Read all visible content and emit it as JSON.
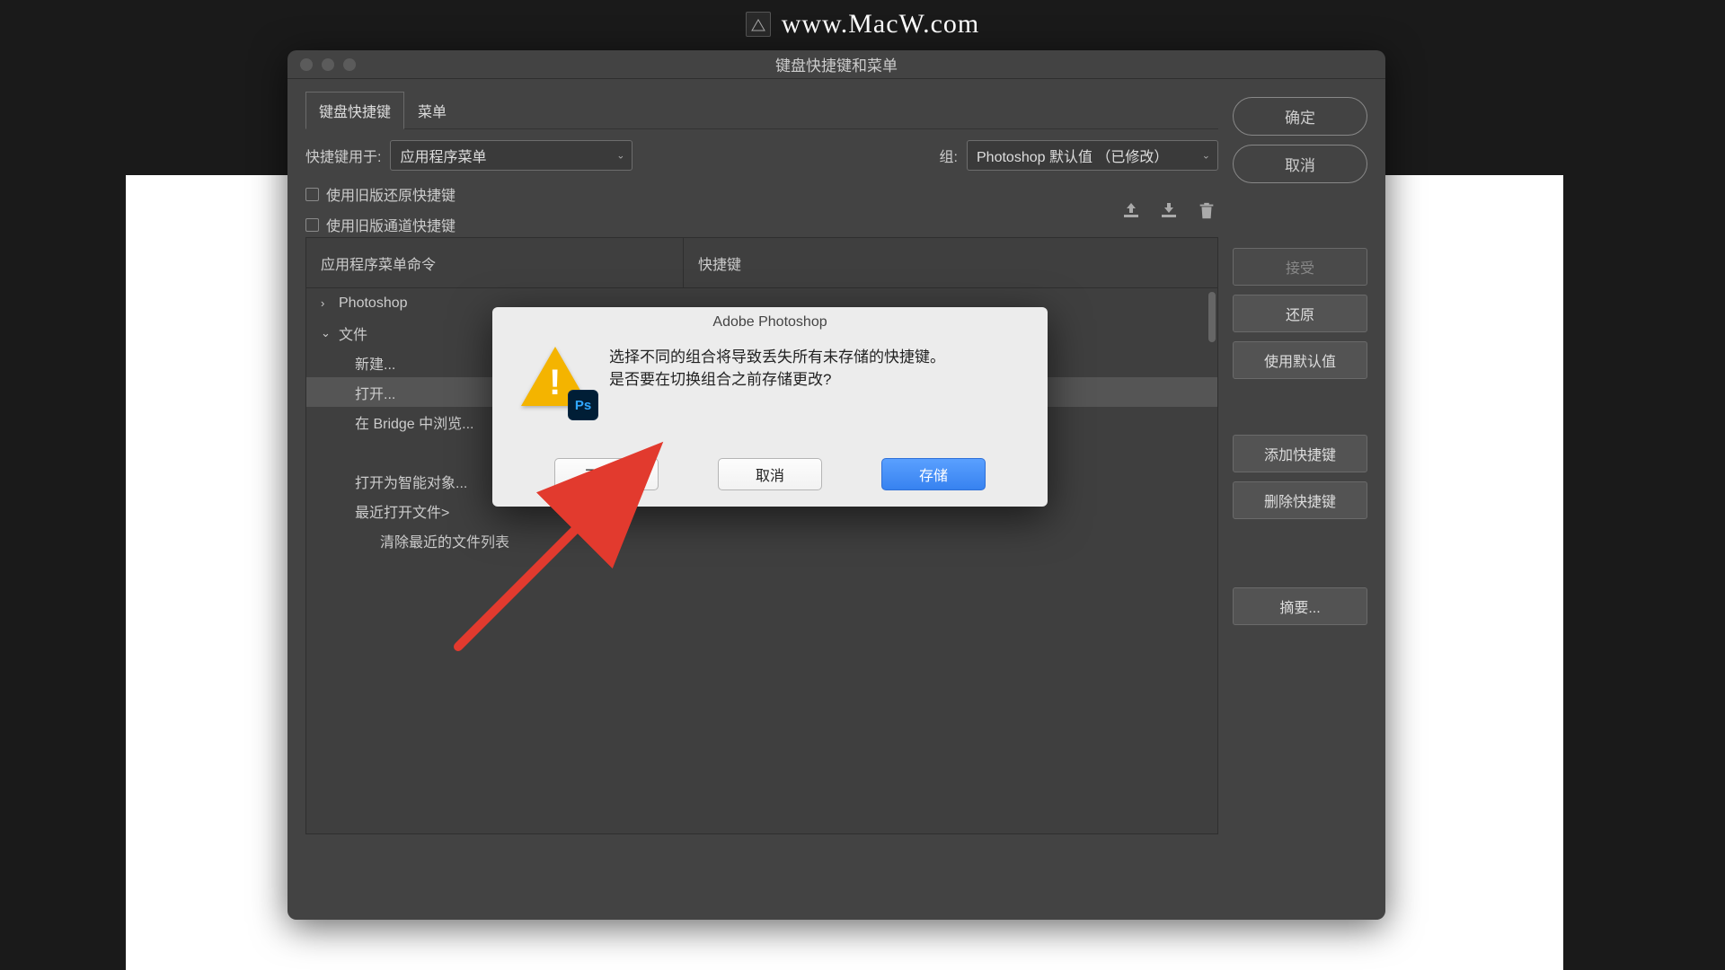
{
  "watermark": {
    "text": "www.MacW.com"
  },
  "window": {
    "title": "键盘快捷键和菜单",
    "tabs": [
      "键盘快捷键",
      "菜单"
    ],
    "shortcutsFor_label": "快捷键用于:",
    "shortcutsFor_value": "应用程序菜单",
    "group_label": "组:",
    "group_value": "Photoshop 默认值 （已修改）",
    "cb1": "使用旧版还原快捷键",
    "cb2": "使用旧版通道快捷键",
    "th1": "应用程序菜单命令",
    "th2": "快捷键",
    "rows": [
      {
        "label": "Photoshop",
        "caret": "›",
        "indent": 0
      },
      {
        "label": "文件",
        "caret": "⌄",
        "indent": 0
      },
      {
        "label": "新建...",
        "indent": 1
      },
      {
        "label": "打开...",
        "indent": 1,
        "selected": true
      },
      {
        "label": "在 Bridge 中浏览...",
        "indent": 1
      },
      {
        "label": "打开为智能对象...",
        "indent": 1
      },
      {
        "label": "最近打开文件>",
        "indent": 1
      },
      {
        "label": "清除最近的文件列表",
        "indent": 2
      }
    ],
    "rightTop": {
      "ok": "确定",
      "cancel": "取消"
    },
    "sideBtns1": {
      "accept": "接受",
      "revert": "还原",
      "defaults": "使用默认值"
    },
    "sideBtns2": {
      "add": "添加快捷键",
      "del": "删除快捷键"
    },
    "sideBtn3": "摘要..."
  },
  "alert": {
    "title": "Adobe Photoshop",
    "line1": "选择不同的组合将导致丢失所有未存储的快捷键。",
    "line2": "是否要在切换组合之前存储更改?",
    "dontSave": "不存储",
    "cancel": "取消",
    "save": "存储",
    "ps": "Ps"
  }
}
